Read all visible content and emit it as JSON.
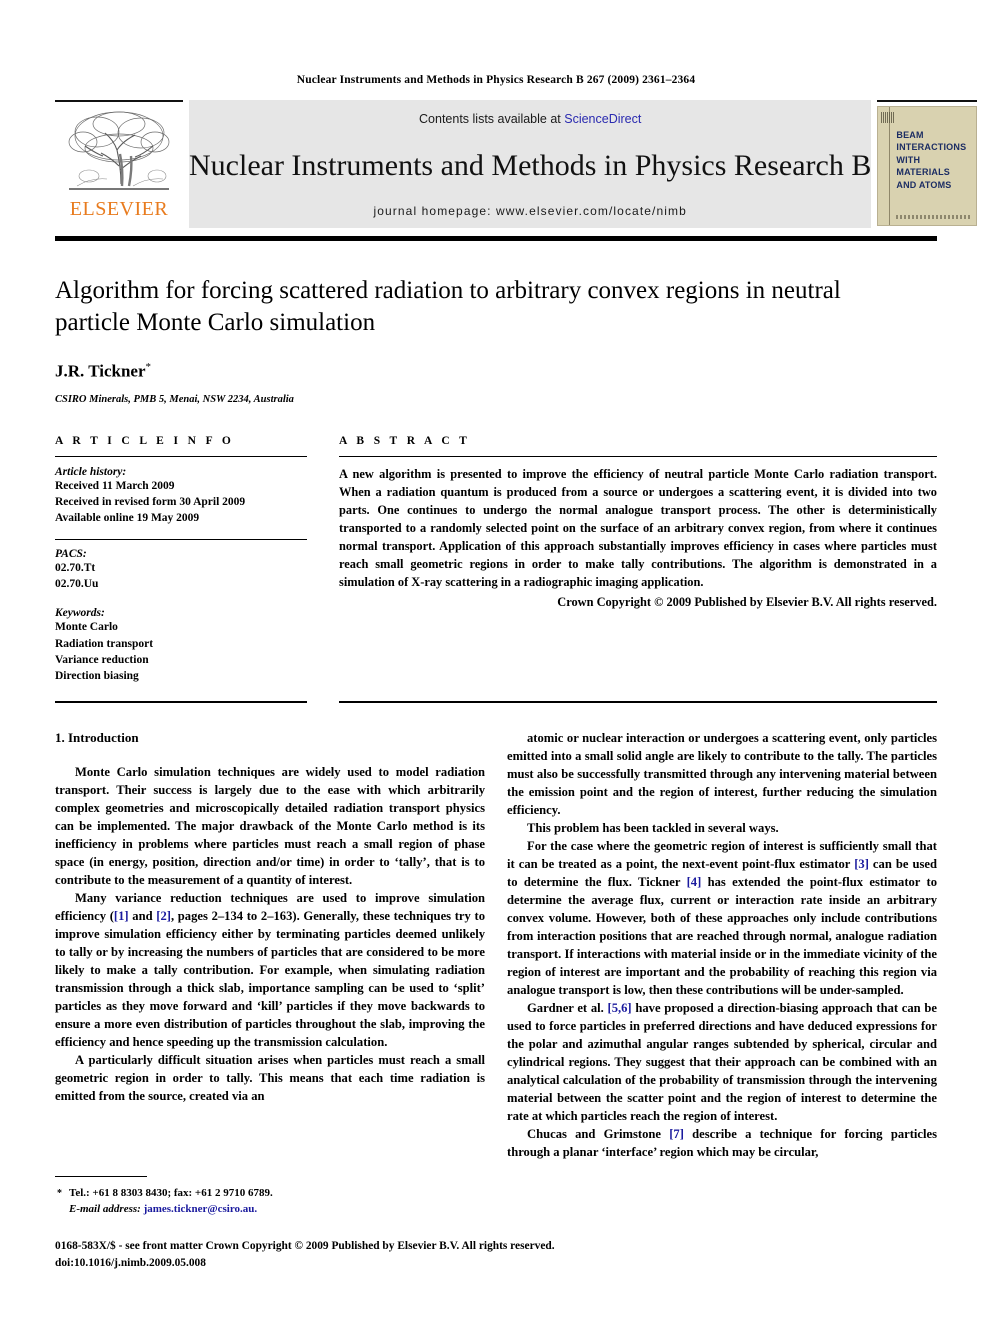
{
  "running_head": "Nuclear Instruments and Methods in Physics Research B 267 (2009) 2361–2364",
  "masthead": {
    "publisher_word": "ELSEVIER",
    "contents_prefix": "Contents lists available at ",
    "contents_link": "ScienceDirect",
    "journal_title": "Nuclear Instruments and Methods in Physics Research B",
    "homepage": "journal homepage: www.elsevier.com/locate/nimb",
    "cover": {
      "line1": "BEAM",
      "line2": "INTERACTIONS",
      "line3": "WITH",
      "line4": "MATERIALS",
      "line5": "AND ATOMS"
    }
  },
  "article": {
    "title": "Algorithm for forcing scattered radiation to arbitrary convex regions in neutral particle Monte Carlo simulation",
    "author": "J.R. Tickner",
    "author_mark": "*",
    "affiliation": "CSIRO Minerals, PMB 5, Menai, NSW 2234, Australia"
  },
  "info": {
    "label": "A R T I C L E   I N F O",
    "history_head": "Article history:",
    "history": [
      "Received 11 March 2009",
      "Received in revised form 30 April 2009",
      "Available online 19 May 2009"
    ],
    "pacs_head": "PACS:",
    "pacs": [
      "02.70.Tt",
      "02.70.Uu"
    ],
    "keywords_head": "Keywords:",
    "keywords": [
      "Monte Carlo",
      "Radiation transport",
      "Variance reduction",
      "Direction biasing"
    ]
  },
  "abstract": {
    "label": "A B S T R A C T",
    "text": "A new algorithm is presented to improve the efficiency of neutral particle Monte Carlo radiation transport. When a radiation quantum is produced from a source or undergoes a scattering event, it is divided into two parts. One continues to undergo the normal analogue transport process. The other is deterministically transported to a randomly selected point on the surface of an arbitrary convex region, from where it continues normal transport. Application of this approach substantially improves efficiency in cases where particles must reach small geometric regions in order to make tally contributions. The algorithm is demonstrated in a simulation of X-ray scattering in a radiographic imaging application.",
    "copyright": "Crown Copyright © 2009 Published by Elsevier B.V. All rights reserved."
  },
  "body": {
    "section_title": "1. Introduction",
    "left": {
      "p1": "Monte Carlo simulation techniques are widely used to model radiation transport. Their success is largely due to the ease with which arbitrarily complex geometries and microscopically detailed radiation transport physics can be implemented. The major drawback of the Monte Carlo method is its inefficiency in problems where particles must reach a small region of phase space (in energy, position, direction and/or time) in order to ‘tally’, that is to contribute to the measurement of a quantity of interest.",
      "p2_a": "Many variance reduction techniques are used to improve simulation efficiency (",
      "p2_ref1": "[1]",
      "p2_b": " and ",
      "p2_ref2": "[2]",
      "p2_c": ", pages 2–134 to 2–163). Generally, these techniques try to improve simulation efficiency either by terminating particles deemed unlikely to tally or by increasing the numbers of particles that are considered to be more likely to make a tally contribution. For example, when simulating radiation transmission through a thick slab, importance sampling can be used to ‘split’ particles as they move forward and ‘kill’ particles if they move backwards to ensure a more even distribution of particles throughout the slab, improving the efficiency and hence speeding up the transmission calculation.",
      "p3": "A particularly difficult situation arises when particles must reach a small geometric region in order to tally. This means that each time radiation is emitted from the source, created via an"
    },
    "right": {
      "p1": "atomic or nuclear interaction or undergoes a scattering event, only particles emitted into a small solid angle are likely to contribute to the tally. The particles must also be successfully transmitted through any intervening material between the emission point and the region of interest, further reducing the simulation efficiency.",
      "p2": "This problem has been tackled in several ways.",
      "p3_a": "For the case where the geometric region of interest is sufficiently small that it can be treated as a point, the next-event point-flux estimator ",
      "p3_ref1": "[3]",
      "p3_b": " can be used to determine the flux. Tickner ",
      "p3_ref2": "[4]",
      "p3_c": " has extended the point-flux estimator to determine the average flux, current or interaction rate inside an arbitrary convex volume. However, both of these approaches only include contributions from interaction positions that are reached through normal, analogue radiation transport. If interactions with material inside or in the immediate vicinity of the region of interest are important and the probability of reaching this region via analogue transport is low, then these contributions will be under-sampled.",
      "p4_a": "Gardner et al. ",
      "p4_ref": "[5,6]",
      "p4_b": " have proposed a direction-biasing approach that can be used to force particles in preferred directions and have deduced expressions for the polar and azimuthal angular ranges subtended by spherical, circular and cylindrical regions. They suggest that their approach can be combined with an analytical calculation of the probability of transmission through the intervening material between the scatter point and the region of interest to determine the rate at which particles reach the region of interest.",
      "p5_a": "Chucas and Grimstone ",
      "p5_ref": "[7]",
      "p5_b": " describe a technique for forcing particles through a planar ‘interface’ region which may be circular,"
    }
  },
  "footnote": {
    "star": "*",
    "contact": "Tel.: +61 8 8303 8430; fax: +61 2 9710 6789.",
    "email_label": "E-mail address:",
    "email": "james.tickner@csiro.au."
  },
  "imprint": {
    "line1": "0168-583X/$ - see front matter Crown Copyright © 2009 Published by Elsevier B.V. All rights reserved.",
    "line2": "doi:10.1016/j.nimb.2009.05.008"
  },
  "colors": {
    "elsevier_orange": "#E87B1E",
    "link_blue": "#2a2ab0",
    "ref_blue": "#1a1a9e",
    "band_grey": "#e6e6e6",
    "cover_tan": "#d9d2b0",
    "cover_navy": "#1c2d63"
  }
}
